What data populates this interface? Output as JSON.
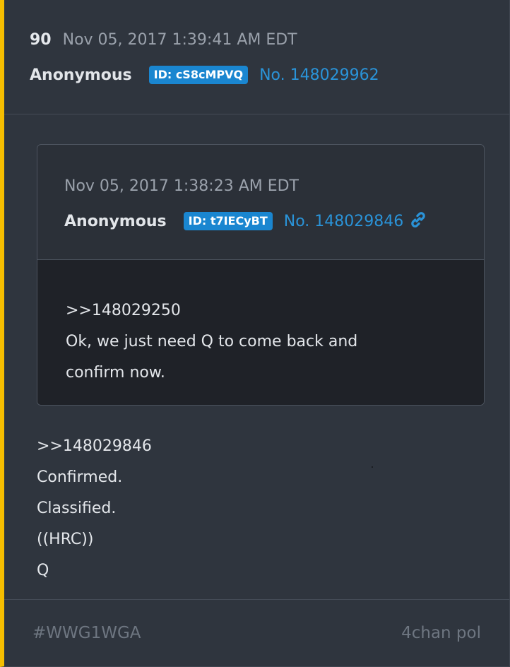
{
  "post": {
    "number": "90",
    "date": "Nov 05, 2017 1:39:41 AM EDT",
    "author": "Anonymous",
    "id_badge": "ID: cS8cMPVQ",
    "post_no": "No. 148029962"
  },
  "quoted": {
    "date": "Nov 05, 2017 1:38:23 AM EDT",
    "author": "Anonymous",
    "id_badge": "ID: t7IECyBT",
    "post_no": "No. 148029846",
    "lines": [
      ">>148029250",
      "Ok, we just need Q to come back and",
      "confirm now."
    ]
  },
  "body": {
    "lines": [
      ">>148029846",
      "Confirmed.",
      "Classified.",
      "((HRC))",
      "Q"
    ]
  },
  "footer": {
    "tag": "#WWG1WGA",
    "source": "4chan pol"
  },
  "colors": {
    "accent_bar": "#f6be00",
    "link": "#2a93d8",
    "badge": "#1a86d0"
  },
  "icons": {
    "link": "link-icon"
  }
}
